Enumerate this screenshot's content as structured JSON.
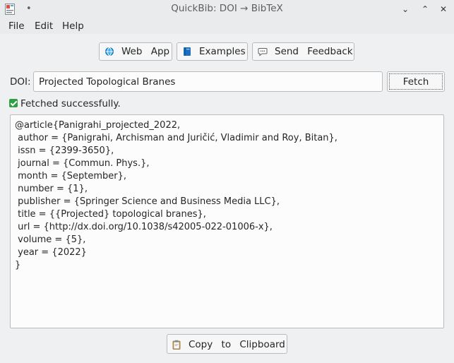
{
  "window": {
    "title": "QuickBib: DOI → BibTeX",
    "title_dot": "•",
    "minimize_glyph": "⌄",
    "maximize_glyph": "⌃",
    "close_glyph": "✕"
  },
  "menu": {
    "items": [
      {
        "label": "File"
      },
      {
        "label": "Edit"
      },
      {
        "label": "Help"
      }
    ]
  },
  "toolbar": {
    "web_app_label": "Web App",
    "web_app_icon": "globe-icon",
    "examples_label": "Examples",
    "examples_icon": "book-icon",
    "feedback_label": "Send Feedback",
    "feedback_icon": "speech-bubble-icon"
  },
  "doi": {
    "label": "DOI:",
    "value": "Projected Topological Branes"
  },
  "fetch_button": {
    "label": "Fetch"
  },
  "status": {
    "text": "Fetched successfully.",
    "icon": "check-icon",
    "color": "#2ea043"
  },
  "output": {
    "lines": [
      "@article{Panigrahi_projected_2022,",
      " author = {Panigrahi, Archisman and Juričić, Vladimir and Roy, Bitan},",
      " issn = {2399-3650},",
      " journal = {Commun. Phys.},",
      " month = {September},",
      " number = {1},",
      " publisher = {Springer Science and Business Media LLC},",
      " title = {{Projected} topological branes},",
      " url = {http://dx.doi.org/10.1038/s42005-022-01006-x},",
      " volume = {5},",
      " year = {2022}",
      "}"
    ]
  },
  "copy_button": {
    "label": "Copy to Clipboard",
    "icon": "clipboard-icon"
  }
}
